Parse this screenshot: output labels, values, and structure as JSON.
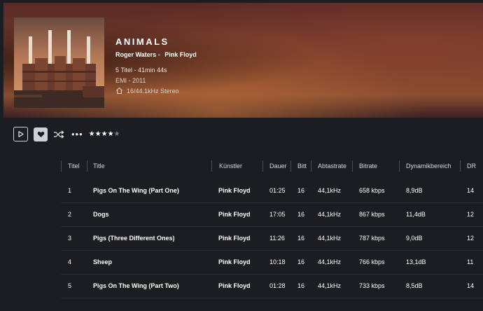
{
  "album": {
    "title": "ANIMALS",
    "artists": [
      "Roger Waters -",
      "Pink Floyd"
    ],
    "summary": "5 Titel - 41min 44s",
    "label_year": "EMI - 2011",
    "quality": "16/44.1kHz Stereo"
  },
  "controls": {
    "icons": [
      "play-icon",
      "heart-icon",
      "shuffle-icon",
      "more-icon"
    ],
    "rating": 4,
    "rating_max": 5,
    "more_label": "•••"
  },
  "columns": {
    "track": "Titel",
    "title": "Title",
    "artist": "Künstler",
    "duration": "Dauer",
    "bit": "Bitt",
    "sample_rate": "Abtastrate",
    "bitrate": "Bitrate",
    "dynamic_range": "Dynamikbereich",
    "dr": "DR"
  },
  "tracks": [
    {
      "no": "1",
      "title": "Pigs On The Wing (Part One)",
      "artist": "Pink Floyd",
      "duration": "01:25",
      "bit": "16",
      "sample_rate": "44,1kHz",
      "bitrate": "658 kbps",
      "dynamic_range": "8,9dB",
      "dr": "14"
    },
    {
      "no": "2",
      "title": "Dogs",
      "artist": "Pink Floyd",
      "duration": "17:05",
      "bit": "16",
      "sample_rate": "44,1kHz",
      "bitrate": "867 kbps",
      "dynamic_range": "11,4dB",
      "dr": "12"
    },
    {
      "no": "3",
      "title": "Pigs (Three Different Ones)",
      "artist": "Pink Floyd",
      "duration": "11:26",
      "bit": "16",
      "sample_rate": "44,1kHz",
      "bitrate": "787 kbps",
      "dynamic_range": "9,0dB",
      "dr": "12"
    },
    {
      "no": "4",
      "title": "Sheep",
      "artist": "Pink Floyd",
      "duration": "10:18",
      "bit": "16",
      "sample_rate": "44,1kHz",
      "bitrate": "766 kbps",
      "dynamic_range": "13,1dB",
      "dr": "11"
    },
    {
      "no": "5",
      "title": "Pigs On The Wing (Part Two)",
      "artist": "Pink Floyd",
      "duration": "01:28",
      "bit": "16",
      "sample_rate": "44,1kHz",
      "bitrate": "733 kbps",
      "dynamic_range": "8,5dB",
      "dr": "14"
    }
  ],
  "colors": {
    "background": "#1b1d21",
    "star_filled": "#ffffff",
    "star_empty": "#7a7c82"
  }
}
